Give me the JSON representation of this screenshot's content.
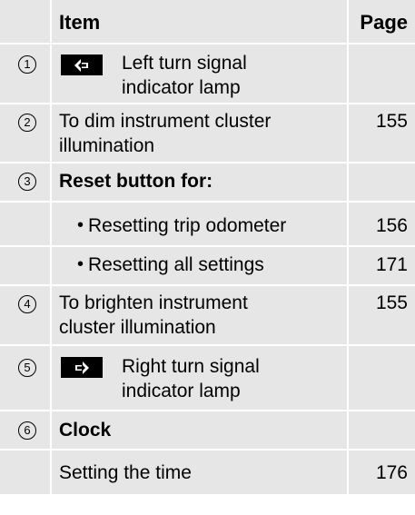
{
  "header": {
    "item": "Item",
    "page": "Page"
  },
  "rows": [
    {
      "num": "1",
      "icon": "left-arrow-lamp",
      "line1": "Left turn signal",
      "line2": "indicator lamp",
      "page": ""
    },
    {
      "num": "2",
      "line1": "To dim instrument cluster",
      "line2": "illumination",
      "page": "155"
    },
    {
      "num": "3",
      "line1": "Reset button for:",
      "page": ""
    },
    {
      "bullet": "•",
      "text": "Resetting trip odometer",
      "page": "156"
    },
    {
      "bullet": "•",
      "text": "Resetting all settings",
      "page": "171"
    },
    {
      "num": "4",
      "line1": "To brighten instrument",
      "line2": "cluster illumination",
      "page": "155"
    },
    {
      "num": "5",
      "icon": "right-arrow-lamp",
      "line1": "Right turn signal",
      "line2": "indicator lamp",
      "page": ""
    },
    {
      "num": "6",
      "line1": "Clock",
      "page": ""
    },
    {
      "text": "Setting the time",
      "page": "176"
    }
  ]
}
